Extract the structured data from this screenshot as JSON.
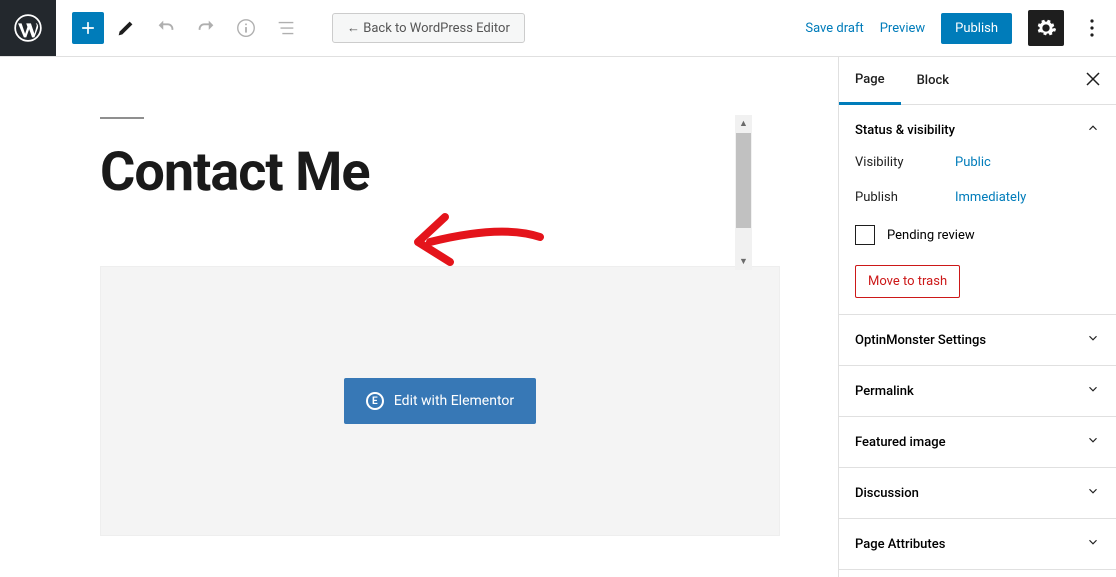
{
  "toolbar": {
    "back_label": "← Back to WordPress Editor",
    "save_draft": "Save draft",
    "preview": "Preview",
    "publish": "Publish"
  },
  "page": {
    "title": "Contact Me",
    "elementor_button": "Edit with Elementor"
  },
  "sidebar": {
    "tabs": {
      "page": "Page",
      "block": "Block"
    },
    "status": {
      "heading": "Status & visibility",
      "visibility_label": "Visibility",
      "visibility_value": "Public",
      "publish_label": "Publish",
      "publish_value": "Immediately",
      "pending_review": "Pending review",
      "move_to_trash": "Move to trash"
    },
    "panels": {
      "optinmonster": "OptinMonster Settings",
      "permalink": "Permalink",
      "featured_image": "Featured image",
      "discussion": "Discussion",
      "page_attributes": "Page Attributes"
    }
  },
  "icons": {
    "wp_logo": "wordpress",
    "add": "plus",
    "edit": "pencil",
    "undo": "undo",
    "redo": "redo",
    "info": "info",
    "outline": "outline",
    "settings": "gear",
    "more": "dots-vertical",
    "close": "close",
    "chev_up": "chevron-up",
    "chev_down": "chevron-down"
  },
  "colors": {
    "primary": "#007cba",
    "elementor": "#3778b6",
    "danger": "#cc1818",
    "dark": "#1e1e1e"
  }
}
